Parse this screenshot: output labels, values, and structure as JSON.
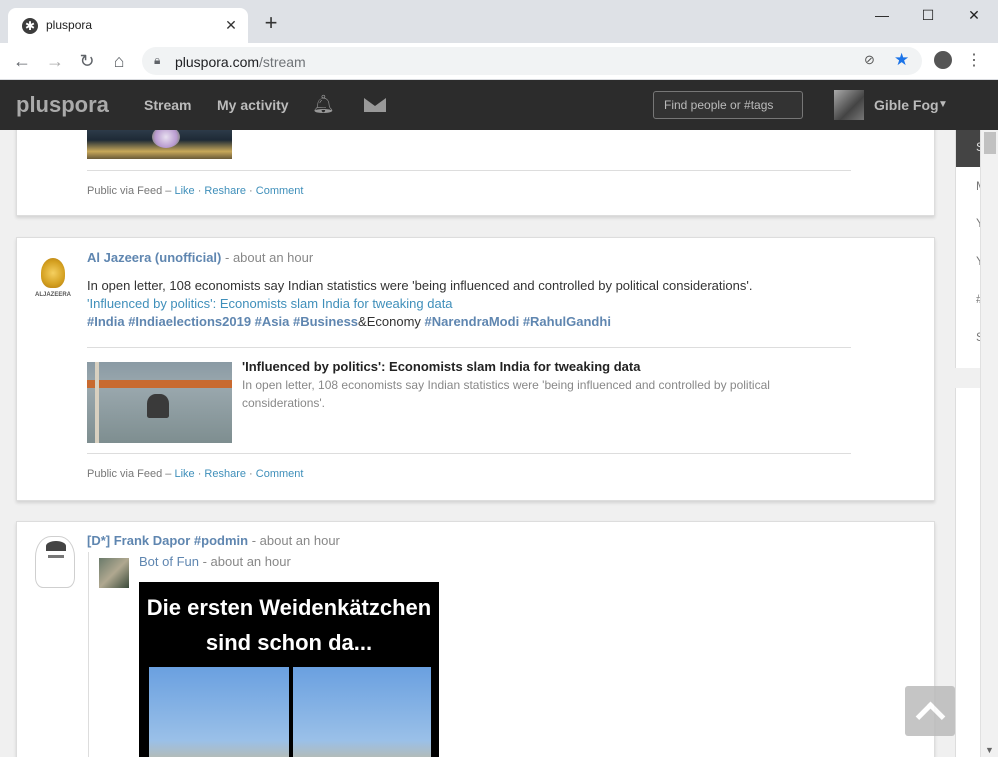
{
  "browser": {
    "tab_title": "pluspora",
    "url_host": "pluspora.com",
    "url_path": "/stream"
  },
  "header": {
    "brand": "pluspora",
    "nav": [
      "Stream",
      "My activity"
    ],
    "search_placeholder": "Find people or #tags",
    "user_name": "Gible Fog"
  },
  "posts": [
    {
      "footer_prefix": "Public via Feed –",
      "actions": [
        "Like",
        "Reshare",
        "Comment"
      ]
    },
    {
      "author": "Al Jazeera (unofficial)",
      "time": "- about an hour",
      "avatar_text": "ALJAZEERA",
      "text": "In open letter, 108 economists say Indian statistics were 'being influenced and controlled by political considerations'.",
      "link": "'Influenced by politics': Economists slam India for tweaking data",
      "tags": [
        "#India",
        "#Indiaelections2019",
        "#Asia",
        "#Business"
      ],
      "tag_suffix": "&Economy",
      "tags2": [
        "#NarendraModi",
        "#RahulGandhi"
      ],
      "og_title": "'Influenced by politics': Economists slam India for tweaking data",
      "og_desc": "In open letter, 108 economists say Indian statistics were 'being influenced and controlled by political considerations'.",
      "footer_prefix": "Public via Feed –",
      "actions": [
        "Like",
        "Reshare",
        "Comment"
      ]
    },
    {
      "author": "[D*] Frank Dapor #podmin",
      "time": "- about an hour",
      "reshare_author": "Bot of Fun",
      "reshare_time": "- about an hour",
      "image_text_line1": "Die ersten Weidenkätzchen",
      "image_text_line2": "sind schon da..."
    }
  ],
  "sidebar_letters": [
    "S",
    "M",
    "Y",
    "Y",
    "#",
    "S"
  ]
}
